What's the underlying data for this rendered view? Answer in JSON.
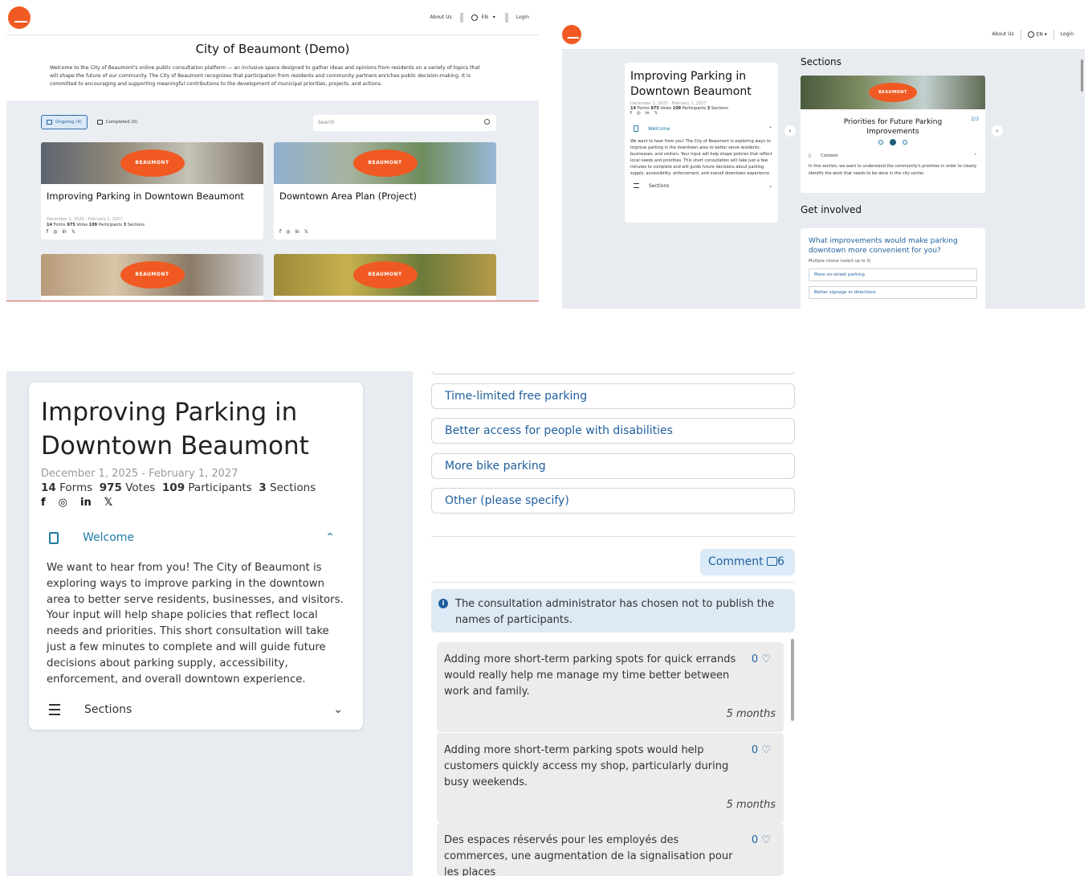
{
  "nav": {
    "about": "About Us",
    "lang": "EN",
    "lang_caret": "▾",
    "login": "Login"
  },
  "home": {
    "title": "City of Beaumont (Demo)",
    "intro": "Welcome to the City of Beaumont's online public consultation platform — an inclusive space designed to gather ideas and opinions from residents on a variety of topics that will shape the future of our community. The City of Beaumont recognizes that participation from residents and community partners enriches public decision-making. It is committed to encouraging and supporting meaningful contributions to the development of municipal priorities, projects, and actions.",
    "tab_ongoing": "Ongoing (4)",
    "tab_completed": "Completed (0)",
    "search_placeholder": "Search",
    "cards": [
      {
        "title": "Improving Parking in Downtown Beaumont",
        "dates": "December 1, 2025 - February 1, 2027",
        "forms": "14",
        "forms_l": "Forms",
        "votes": "975",
        "votes_l": "Votes",
        "participants": "109",
        "participants_l": "Participants",
        "sections": "3",
        "sections_l": "Sections"
      },
      {
        "title": "Downtown Area Plan (Project)"
      }
    ],
    "badge": "BEAUMONT"
  },
  "social": {
    "facebook": "f",
    "instagram": "◎",
    "linkedin": "in",
    "x": "𝕏"
  },
  "detail": {
    "title": "Improving Parking in Downtown Beaumont",
    "dates": "December 1, 2025 - February 1, 2027",
    "forms": "14",
    "forms_l": "Forms",
    "votes": "975",
    "votes_l": "Votes",
    "participants": "109",
    "participants_l": "Participants",
    "sections": "3",
    "sections_l": "Sections",
    "welcome_label": "Welcome",
    "welcome_body": "We want to hear from you! The City of Beaumont is exploring ways to improve parking in the downtown area to better serve residents, businesses, and visitors. Your input will help shape policies that reflect local needs and priorities. This short consultation will take just a few minutes to complete and will guide future decisions about parking supply, accessibility, enforcement, and overall downtown experience.",
    "sections_label": "Sections",
    "sections_heading": "Sections",
    "slide_title": "Priorities for Future Parking Improvements",
    "slide_count": "2/3",
    "context_label": "Context",
    "context_body": "In this section, we want to understand the community's priorities in order to clearly identify the work that needs to be done in the city center.",
    "get_involved": "Get involved",
    "question": "What improvements would make parking downtown more convenient for you?",
    "question_hint": "Multiple choice (select up to 3)",
    "preview_options": [
      "More on-street parking",
      "Better signage or directions"
    ]
  },
  "survey": {
    "options": [
      "Time-limited free parking",
      "Better access for people with disabilities",
      "More bike parking",
      "Other (please specify)"
    ],
    "comment_label": "Comment",
    "comment_count": "6",
    "notice": "The consultation administrator has chosen not to publish the names of participants.",
    "comments": [
      {
        "text": "Adding more short-term parking spots for quick errands would really help me manage my time better between work and family.",
        "likes": "0",
        "when": "5 months"
      },
      {
        "text": "Adding more short-term parking spots would help customers quickly access my shop, particularly during busy weekends.",
        "likes": "0",
        "when": "5 months"
      },
      {
        "text": "Des espaces réservés pour les employés des commerces, une augmentation de la signalisation pour les places",
        "likes": "0",
        "when": ""
      }
    ]
  },
  "colors": {
    "brand": "#f15a24",
    "accent": "#1f5f9c",
    "panel_bg": "#e8ecf0"
  }
}
